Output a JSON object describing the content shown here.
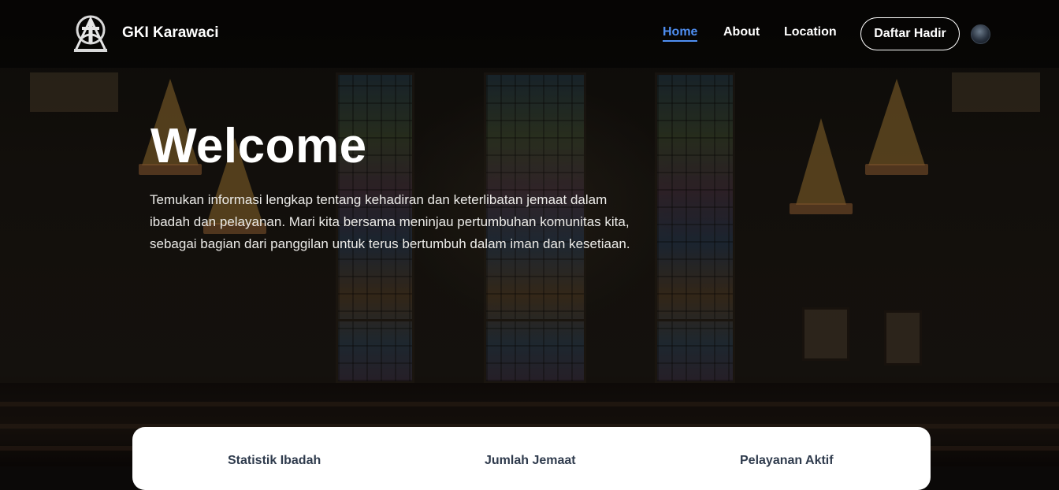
{
  "nav": {
    "brand": "GKI Karawaci",
    "links": [
      {
        "label": "Home",
        "active": true
      },
      {
        "label": "About",
        "active": false
      },
      {
        "label": "Location",
        "active": false
      }
    ],
    "cta_label": "Daftar Hadir",
    "logo_icon": "church-cross-logo-icon",
    "avatar_icon": "user-avatar"
  },
  "hero": {
    "title": "Welcome",
    "description_lines": [
      "Temukan informasi lengkap tentang kehadiran dan keterlibatan jemaat dalam",
      "ibadah dan pelayanan. Mari kita bersama meninjau pertumbuhan komunitas kita,",
      "sebagai bagian dari panggilan untuk terus bertumbuh dalam iman dan kesetiaan."
    ]
  },
  "stats": {
    "items": [
      {
        "label": "Statistik Ibadah"
      },
      {
        "label": "Jumlah Jemaat"
      },
      {
        "label": "Pelayanan Aktif"
      }
    ]
  },
  "colors": {
    "accent": "#4f8ff2",
    "card_text": "#2f3b4d",
    "nav_text": "#ffffff"
  }
}
